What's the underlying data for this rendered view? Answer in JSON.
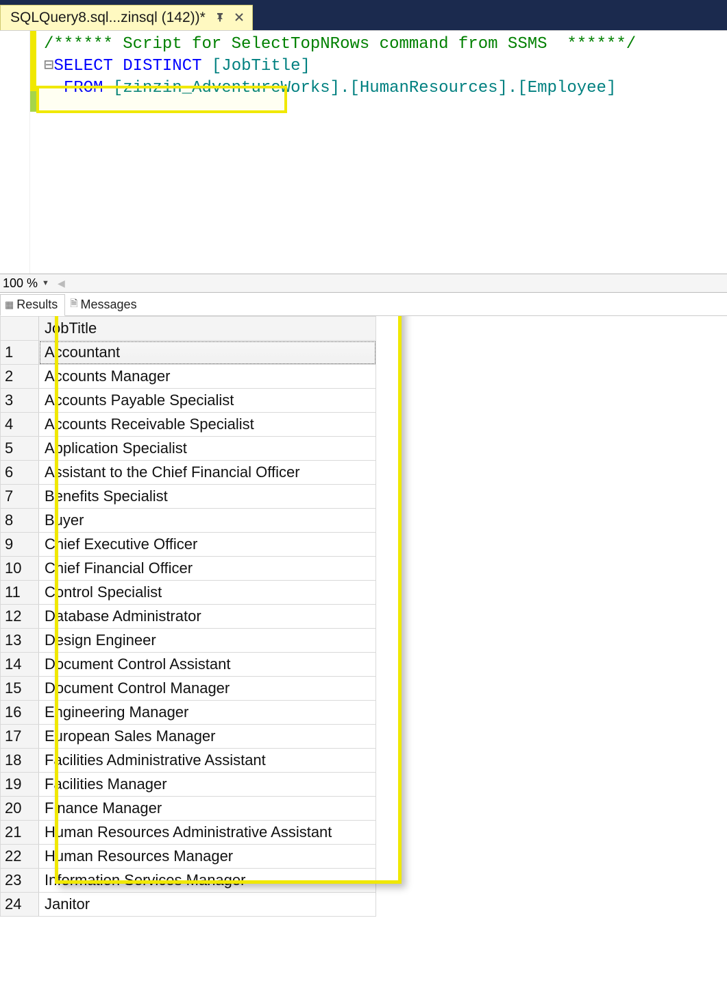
{
  "tab": {
    "title": "SQLQuery8.sql...zinsql (142))*",
    "pinned_aria": "Pin",
    "close_aria": "Close"
  },
  "editor": {
    "comment": "/****** Script for SelectTopNRows command from SSMS  ******/",
    "select": "SELECT",
    "distinct": "DISTINCT",
    "jobtitle": "[JobTitle]",
    "from": "FROM",
    "schema": "[zinzin_AdventureWorks].[HumanResources].[Employee]"
  },
  "zoom": {
    "level": "100 %"
  },
  "result_tabs": {
    "results": "Results",
    "messages": "Messages"
  },
  "grid": {
    "header": "JobTitle",
    "rows": [
      "Accountant",
      "Accounts Manager",
      "Accounts Payable Specialist",
      "Accounts Receivable Specialist",
      "Application Specialist",
      "Assistant to the Chief Financial Officer",
      "Benefits Specialist",
      "Buyer",
      "Chief Executive Officer",
      "Chief Financial Officer",
      "Control Specialist",
      "Database Administrator",
      "Design Engineer",
      "Document Control Assistant",
      "Document Control Manager",
      "Engineering Manager",
      "European Sales Manager",
      "Facilities Administrative Assistant",
      "Facilities Manager",
      "Finance Manager",
      "Human Resources Administrative Assistant",
      "Human Resources Manager",
      "Information Services Manager",
      "Janitor"
    ]
  }
}
